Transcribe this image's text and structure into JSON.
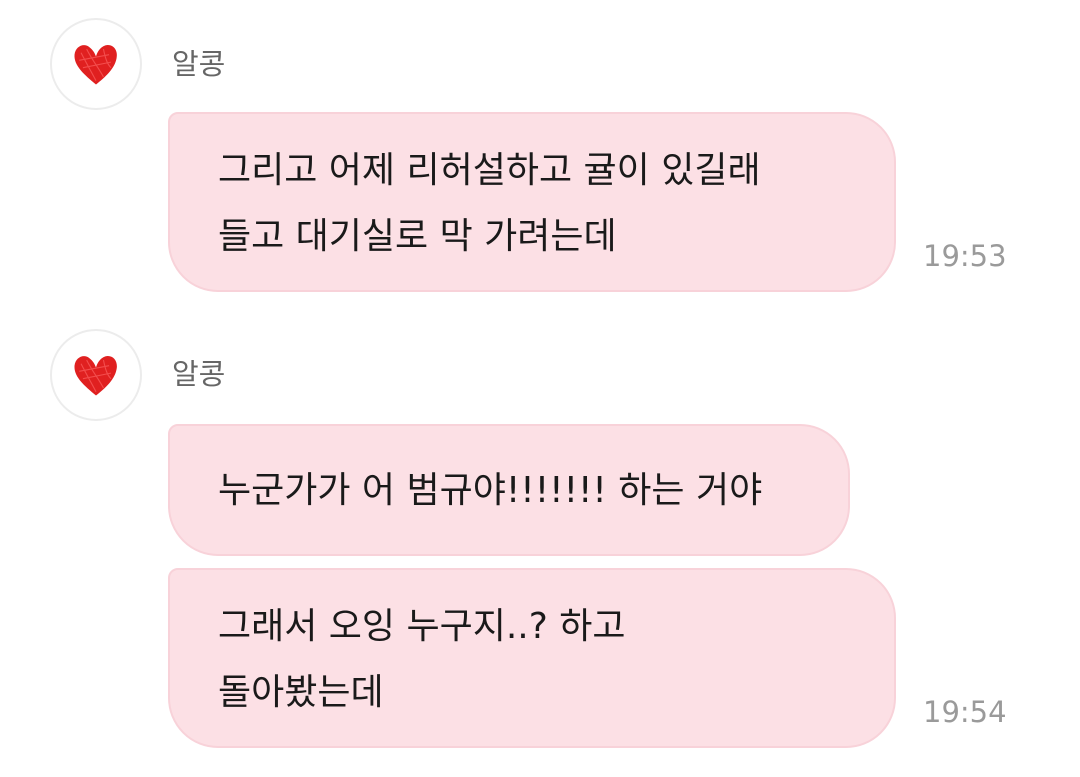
{
  "groups": [
    {
      "sender": "알콩",
      "avatar_icon": "red-heart-icon",
      "messages": [
        {
          "lines": [
            "그리고 어제 리허설하고 귤이 있길래",
            "들고 대기실로 막 가려는데"
          ]
        }
      ],
      "time": "19:53"
    },
    {
      "sender": "알콩",
      "avatar_icon": "red-heart-icon",
      "messages": [
        {
          "lines": [
            "누군가가 어 범규야!!!!!!! 하는 거야"
          ]
        },
        {
          "lines": [
            "그래서 오잉 누구지..? 하고",
            "돌아봤는데"
          ]
        }
      ],
      "time": "19:54"
    }
  ],
  "colors": {
    "bubble_bg": "#fce0e5",
    "heart": "#e02020"
  }
}
